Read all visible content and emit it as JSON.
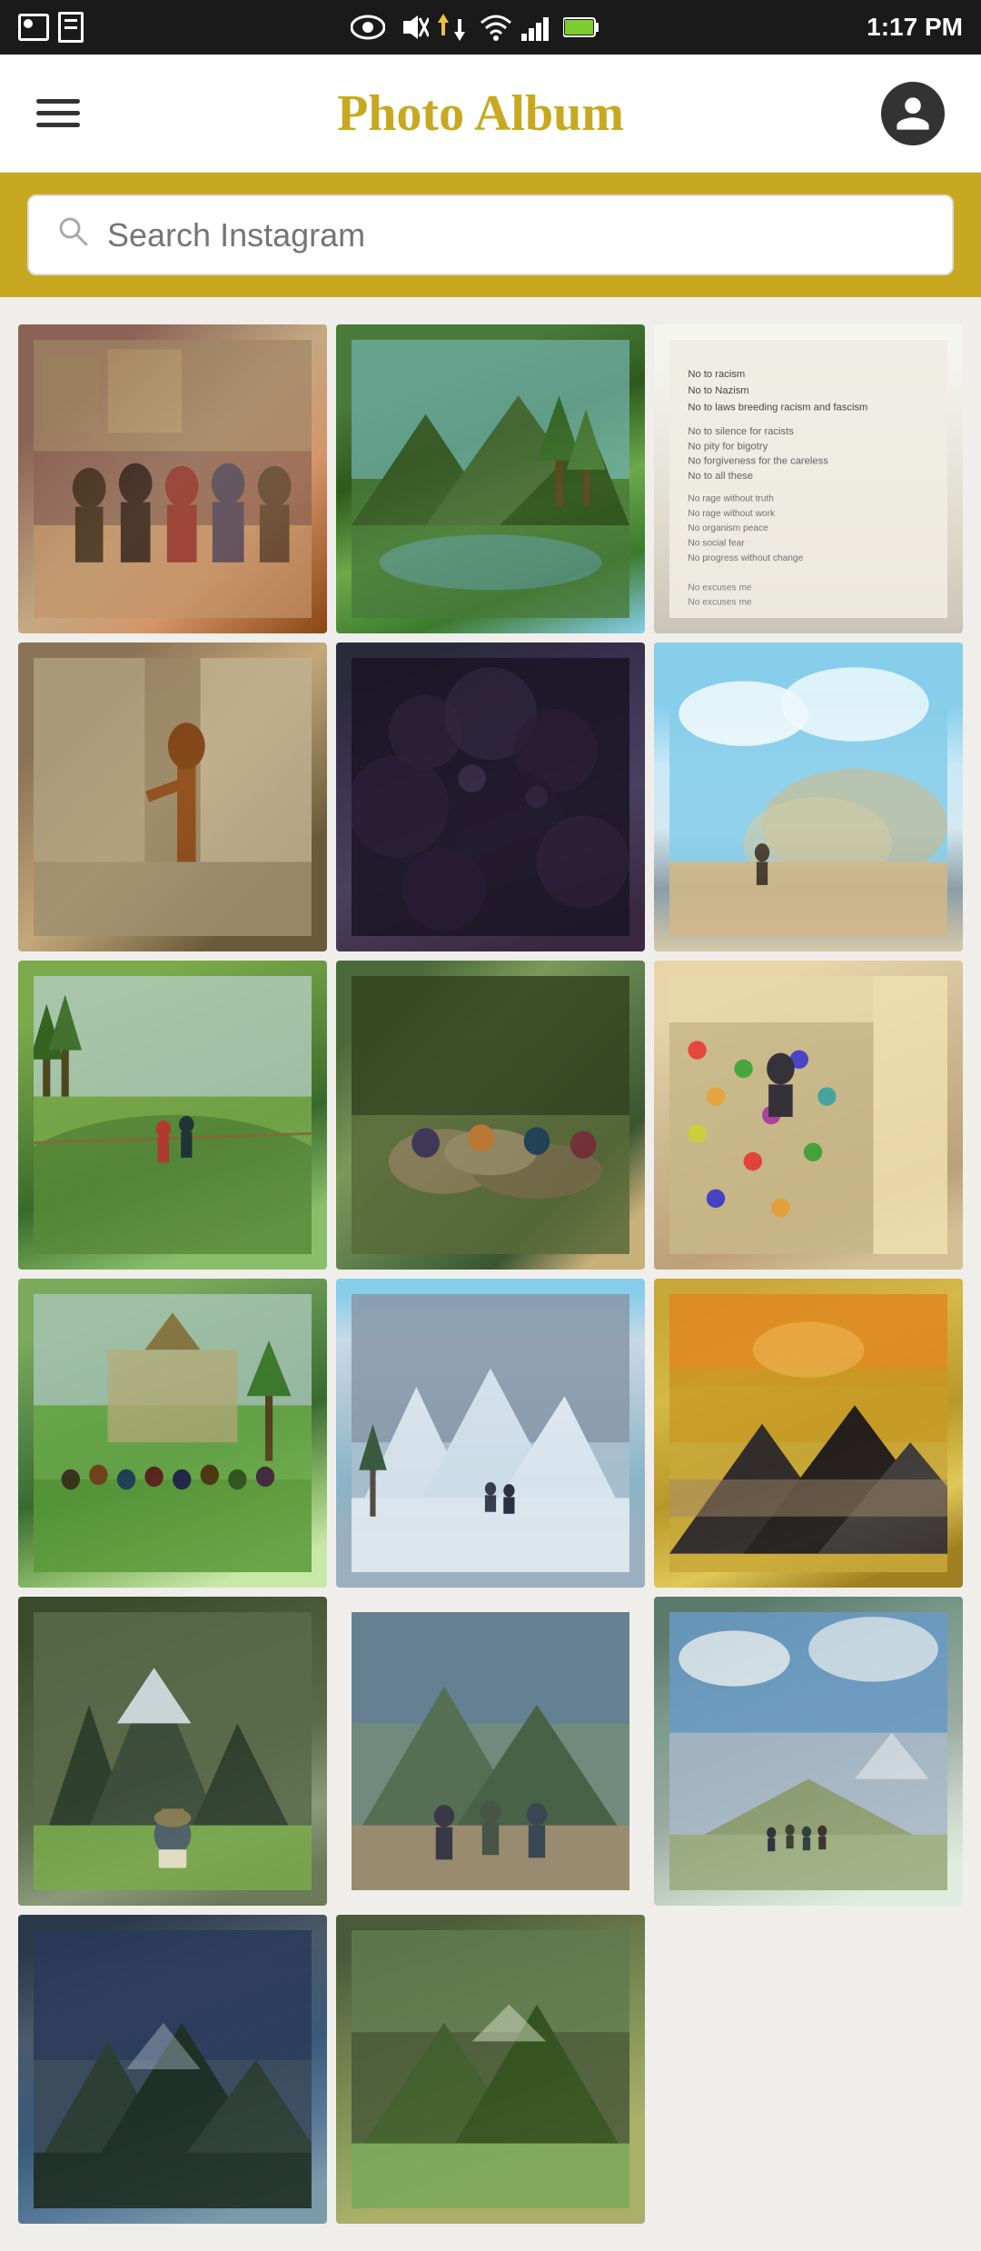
{
  "status": {
    "time": "1:17 PM",
    "icons": [
      "picture",
      "document",
      "eye",
      "mute",
      "download",
      "wifi",
      "signal",
      "battery"
    ]
  },
  "header": {
    "title": "Photo Album",
    "menu_label": "Menu",
    "profile_label": "Profile"
  },
  "search": {
    "placeholder": "Search Instagram"
  },
  "photos": [
    {
      "id": 1,
      "class": "photo-1",
      "alt": "Group photo at event"
    },
    {
      "id": 2,
      "class": "photo-2",
      "alt": "Mountain lake with trees"
    },
    {
      "id": 3,
      "class": "photo-3",
      "alt": "Text document with poem"
    },
    {
      "id": 4,
      "class": "photo-4",
      "alt": "Sculpture in courtyard"
    },
    {
      "id": 5,
      "class": "photo-5",
      "alt": "Dark aerial vegetation"
    },
    {
      "id": 6,
      "class": "photo-6",
      "alt": "Dusty outdoor scene with person"
    },
    {
      "id": 7,
      "class": "photo-7",
      "alt": "People hiking in field"
    },
    {
      "id": 8,
      "class": "photo-8",
      "alt": "Group sitting on rocks"
    },
    {
      "id": 9,
      "class": "photo-9",
      "alt": "Rock climbing wall"
    },
    {
      "id": 10,
      "class": "photo-10",
      "alt": "Outdoor gathering on grass"
    },
    {
      "id": 11,
      "class": "photo-11",
      "alt": "Snowy mountain landscape"
    },
    {
      "id": 12,
      "class": "photo-12",
      "alt": "Sunset over mountains"
    },
    {
      "id": 13,
      "class": "photo-13",
      "alt": "Person reading on ground"
    },
    {
      "id": 14,
      "class": "photo-14",
      "alt": "Hikers on mountain trail"
    },
    {
      "id": 15,
      "class": "photo-15",
      "alt": "Hikers on open mountain"
    },
    {
      "id": 16,
      "class": "photo-16",
      "alt": "Mountain panorama 1"
    },
    {
      "id": 17,
      "class": "photo-17",
      "alt": "Mountain panorama 2"
    }
  ]
}
